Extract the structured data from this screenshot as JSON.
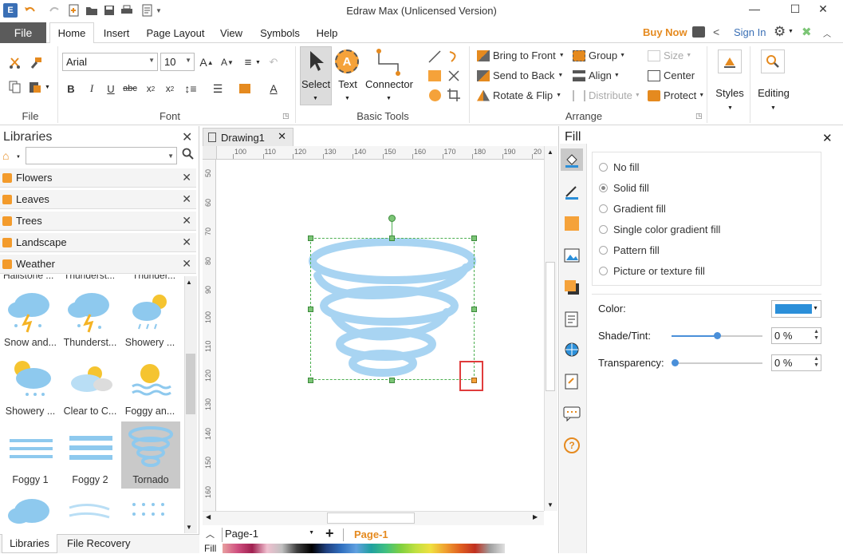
{
  "window": {
    "title": "Edraw Max (Unlicensed Version)"
  },
  "menu": {
    "file": "File",
    "tabs": [
      "Home",
      "Insert",
      "Page Layout",
      "View",
      "Symbols",
      "Help"
    ],
    "buy_now": "Buy Now",
    "sign_in": "Sign In"
  },
  "ribbon": {
    "groups": {
      "file": "File",
      "font": "Font",
      "basic_tools": "Basic Tools",
      "arrange": "Arrange"
    },
    "font": {
      "family": "Arial",
      "size": "10"
    },
    "tools": {
      "select": "Select",
      "text": "Text",
      "connector": "Connector"
    },
    "arrange": {
      "bring_to_front": "Bring to Front",
      "send_to_back": "Send to Back",
      "rotate_flip": "Rotate & Flip",
      "group": "Group",
      "align": "Align",
      "distribute": "Distribute",
      "size": "Size",
      "center": "Center",
      "protect": "Protect"
    },
    "styles": "Styles",
    "editing": "Editing"
  },
  "libraries": {
    "title": "Libraries",
    "categories": [
      "Flowers",
      "Leaves",
      "Trees",
      "Landscape",
      "Weather"
    ],
    "partial_row": [
      "Hailstone ...",
      "Thunderst...",
      "Thunder..."
    ],
    "symbols": [
      [
        "Snow and...",
        "Thunderst...",
        "Showery ..."
      ],
      [
        "Showery ...",
        "Clear to C...",
        "Foggy an..."
      ],
      [
        "Foggy 1",
        "Foggy 2",
        "Tornado"
      ]
    ],
    "bottom_tabs": [
      "Libraries",
      "File Recovery"
    ]
  },
  "document": {
    "tab": "Drawing1",
    "ruler_h": [
      "100",
      "110",
      "120",
      "130",
      "140",
      "150",
      "160",
      "170",
      "180",
      "190",
      "20"
    ],
    "ruler_v": [
      "50",
      "60",
      "70",
      "80",
      "90",
      "100",
      "110",
      "120",
      "130",
      "140",
      "150",
      "160"
    ],
    "page_selector": "Page-1",
    "active_page": "Page-1",
    "fill_label": "Fill"
  },
  "fill": {
    "title": "Fill",
    "options": [
      "No fill",
      "Solid fill",
      "Gradient fill",
      "Single color gradient fill",
      "Pattern fill",
      "Picture or texture fill"
    ],
    "selected": "Solid fill",
    "color_label": "Color:",
    "color_value": "#2b8fd9",
    "shade_label": "Shade/Tint:",
    "shade_value": "0 %",
    "shade_fraction": 0.5,
    "transparency_label": "Transparency:",
    "transparency_value": "0 %",
    "transparency_fraction": 0.0
  },
  "colors": {
    "accent_orange": "#e58a1f",
    "selection": "#7cc576",
    "highlight_box": "#e03c3c",
    "tornado": "#a8d4f2"
  }
}
